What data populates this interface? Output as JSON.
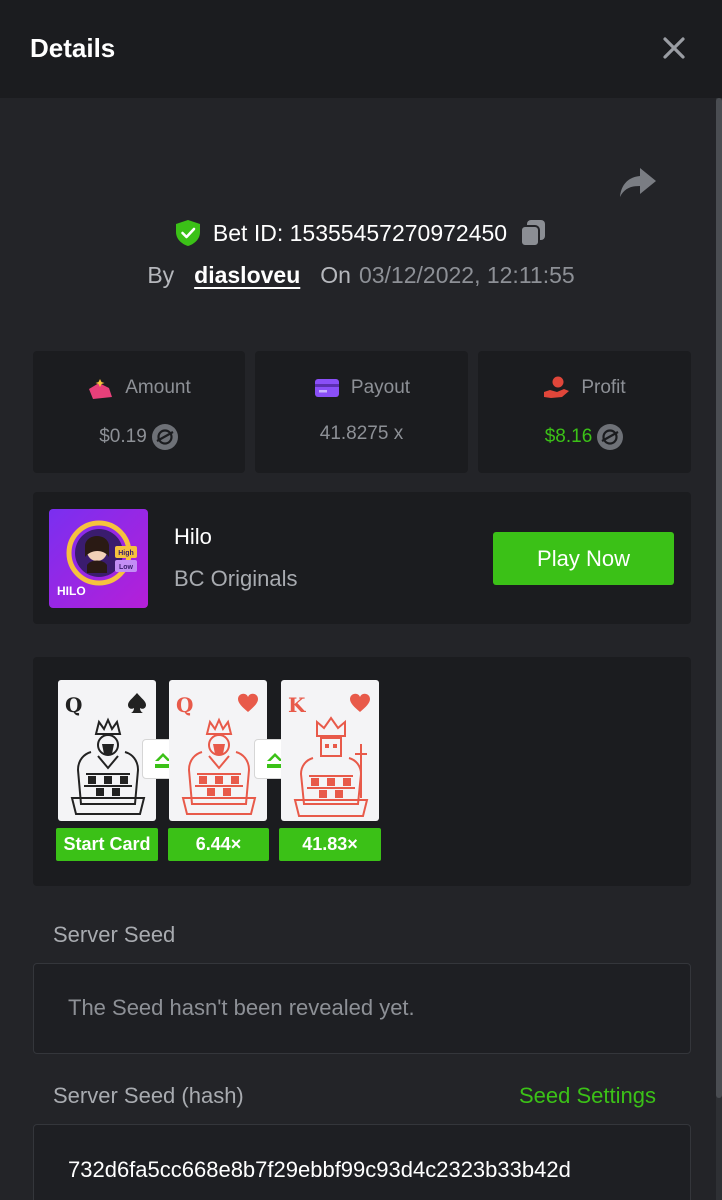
{
  "header": {
    "title": "Details"
  },
  "bet": {
    "id_text": "Bet ID: 15355457270972450",
    "by_label": "By",
    "username": "diasloveu",
    "on_label": "On",
    "datetime": "03/12/2022, 12:11:55"
  },
  "stats": {
    "amount": {
      "label": "Amount",
      "value": "$0.19"
    },
    "payout": {
      "label": "Payout",
      "value": "41.8275 x"
    },
    "profit": {
      "label": "Profit",
      "value": "$8.16"
    }
  },
  "game": {
    "name": "Hilo",
    "provider": "BC Originals",
    "play_label": "Play Now",
    "thumb_title": "HILO",
    "thumb_high": "High",
    "thumb_low": "Low"
  },
  "cards": [
    {
      "rank": "Q",
      "suit": "spade",
      "color": "#222222",
      "label": "Start Card"
    },
    {
      "rank": "Q",
      "suit": "heart",
      "color": "#e85a4a",
      "label": "6.44×"
    },
    {
      "rank": "K",
      "suit": "heart",
      "color": "#e85a4a",
      "label": "41.83×"
    }
  ],
  "seeds": {
    "server_label": "Server Seed",
    "server_value": "The Seed hasn't been revealed yet.",
    "hash_label": "Server Seed (hash)",
    "settings_label": "Seed Settings",
    "hash_value": "732d6fa5cc668e8b7f29ebbf99c93d4c2323b33b42d"
  },
  "colors": {
    "accent": "#3bc117",
    "panel": "#1b1c1f",
    "background": "#232428",
    "heart": "#e85a4a"
  }
}
